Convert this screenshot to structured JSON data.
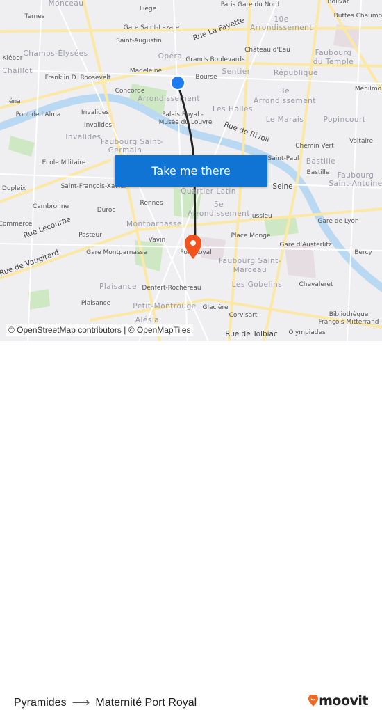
{
  "map": {
    "labels": [
      {
        "text": "Monceau",
        "kind": "dist"
      },
      {
        "text": "Liège",
        "kind": "poi"
      },
      {
        "text": "Paris Gare du Nord",
        "kind": "poi"
      },
      {
        "text": "Bolivar",
        "kind": "poi"
      },
      {
        "text": "Ternes",
        "kind": "poi"
      },
      {
        "text": "Gare Saint-Lazare",
        "kind": "poi"
      },
      {
        "text": "Rue La Fayette",
        "kind": "street"
      },
      {
        "text": "10e",
        "kind": "dist"
      },
      {
        "text": "Arrondissement",
        "kind": "dist"
      },
      {
        "text": "Buttes Chaumont",
        "kind": "poi"
      },
      {
        "text": "Saint-Augustin",
        "kind": "poi"
      },
      {
        "text": "Château d'Eau",
        "kind": "poi"
      },
      {
        "text": "Champs-Élysées",
        "kind": "dist"
      },
      {
        "text": "Opéra",
        "kind": "dist"
      },
      {
        "text": "Grands Boulevards",
        "kind": "poi"
      },
      {
        "text": "Faubourg",
        "kind": "dist"
      },
      {
        "text": "du Temple",
        "kind": "dist"
      },
      {
        "text": "Kléber",
        "kind": "poi"
      },
      {
        "text": "Chaillot",
        "kind": "dist"
      },
      {
        "text": "Madeleine",
        "kind": "poi"
      },
      {
        "text": "Sentier",
        "kind": "dist"
      },
      {
        "text": "République",
        "kind": "dist"
      },
      {
        "text": "Franklin D. Roosevelt",
        "kind": "poi"
      },
      {
        "text": "Bourse",
        "kind": "poi"
      },
      {
        "text": "Concorde",
        "kind": "poi"
      },
      {
        "text": "Arrondissement",
        "kind": "dist"
      },
      {
        "text": "3e",
        "kind": "dist"
      },
      {
        "text": "Arrondissement",
        "kind": "dist"
      },
      {
        "text": "Ménilmo",
        "kind": "poi"
      },
      {
        "text": "Iéna",
        "kind": "poi"
      },
      {
        "text": "Pont de l'Alma",
        "kind": "poi"
      },
      {
        "text": "Invalides",
        "kind": "poi"
      },
      {
        "text": "Palais Royal -",
        "kind": "poi"
      },
      {
        "text": "Musée du Louvre",
        "kind": "poi"
      },
      {
        "text": "Les Halles",
        "kind": "dist"
      },
      {
        "text": "Le Marais",
        "kind": "dist"
      },
      {
        "text": "Popincourt",
        "kind": "dist"
      },
      {
        "text": "Invalides",
        "kind": "poi"
      },
      {
        "text": "Rue de Rivoli",
        "kind": "street"
      },
      {
        "text": "Invalides",
        "kind": "dist"
      },
      {
        "text": "Faubourg Saint-",
        "kind": "dist"
      },
      {
        "text": "Germain",
        "kind": "dist"
      },
      {
        "text": "Chemin Vert",
        "kind": "poi"
      },
      {
        "text": "Voltaire",
        "kind": "poi"
      },
      {
        "text": "École Militaire",
        "kind": "poi"
      },
      {
        "text": "Saint-Paul",
        "kind": "poi"
      },
      {
        "text": "Bastille",
        "kind": "dist"
      },
      {
        "text": "Bastille",
        "kind": "poi"
      },
      {
        "text": "Faubourg",
        "kind": "dist"
      },
      {
        "text": "Saint-Antoine",
        "kind": "dist"
      },
      {
        "text": "Dupleix",
        "kind": "poi"
      },
      {
        "text": "Saint-François-Xavier",
        "kind": "poi"
      },
      {
        "text": "Quartier Latin",
        "kind": "dist"
      },
      {
        "text": "Seine",
        "kind": "street"
      },
      {
        "text": "Cambronne",
        "kind": "poi"
      },
      {
        "text": "Duroc",
        "kind": "poi"
      },
      {
        "text": "Rennes",
        "kind": "poi"
      },
      {
        "text": "5e",
        "kind": "dist"
      },
      {
        "text": "Arrondissement",
        "kind": "dist"
      },
      {
        "text": "Jussieu",
        "kind": "poi"
      },
      {
        "text": "Commerce",
        "kind": "poi"
      },
      {
        "text": "Rue Lecourbe",
        "kind": "street"
      },
      {
        "text": "Montparnasse",
        "kind": "dist"
      },
      {
        "text": "Gare de Lyon",
        "kind": "poi"
      },
      {
        "text": "Pasteur",
        "kind": "poi"
      },
      {
        "text": "Vavin",
        "kind": "poi"
      },
      {
        "text": "Place Monge",
        "kind": "poi"
      },
      {
        "text": "Gare d'Austerlitz",
        "kind": "poi"
      },
      {
        "text": "Bercy",
        "kind": "poi"
      },
      {
        "text": "Rue de Vaugirard",
        "kind": "street"
      },
      {
        "text": "Gare Montparnasse",
        "kind": "poi"
      },
      {
        "text": "Port Royal",
        "kind": "poi"
      },
      {
        "text": "Faubourg Saint-",
        "kind": "dist"
      },
      {
        "text": "Marceau",
        "kind": "dist"
      },
      {
        "text": "Plaisance",
        "kind": "dist"
      },
      {
        "text": "Denfert-Rochereau",
        "kind": "poi"
      },
      {
        "text": "Les Gobelins",
        "kind": "dist"
      },
      {
        "text": "Chevaleret",
        "kind": "poi"
      },
      {
        "text": "Plaisance",
        "kind": "poi"
      },
      {
        "text": "Petit-Montrouge",
        "kind": "dist"
      },
      {
        "text": "Glacière",
        "kind": "poi"
      },
      {
        "text": "Corvisart",
        "kind": "poi"
      },
      {
        "text": "Bibliothèque",
        "kind": "poi"
      },
      {
        "text": "François Mitterrand",
        "kind": "poi"
      },
      {
        "text": "Alésia",
        "kind": "dist"
      },
      {
        "text": "Rue de Tolbiac",
        "kind": "street"
      },
      {
        "text": "Olympiades",
        "kind": "poi"
      }
    ],
    "origin_marker_color": "#1e7bf0",
    "destination_marker_color": "#f2521b",
    "route_color": "#222222",
    "water_color": "#b9d8f2",
    "park_color": "#cfe8c4"
  },
  "cta": {
    "label": "Take me there",
    "color": "#0f74d4"
  },
  "attribution": "© OpenStreetMap contributors | © OpenMapTiles",
  "footer": {
    "origin": "Pyramides",
    "arrow_icon": "arrow-right-icon",
    "destination": "Maternité Port Royal",
    "brand": "moovit",
    "brand_color": "#f26a21"
  }
}
